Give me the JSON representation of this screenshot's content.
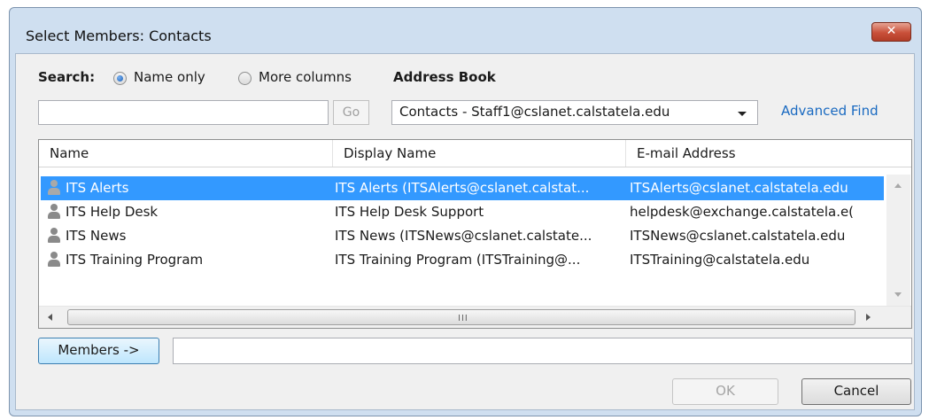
{
  "window": {
    "title": "Select Members: Contacts",
    "close_label": "✕"
  },
  "search": {
    "label": "Search:",
    "option_name_only": "Name only",
    "option_more_columns": "More columns",
    "selected_option": "Name only",
    "input_value": "",
    "go_label": "Go"
  },
  "address_book": {
    "label": "Address Book",
    "selected": "Contacts - Staff1@cslanet.calstatela.edu",
    "advanced_find": "Advanced Find"
  },
  "list": {
    "columns": [
      "Name",
      "Display Name",
      "E-mail Address"
    ],
    "rows": [
      {
        "name": "ITS Alerts",
        "display_name": "ITS Alerts (ITSAlerts@cslanet.calstat...",
        "email": "ITSAlerts@cslanet.calstatela.edu",
        "selected": true
      },
      {
        "name": "ITS Help Desk",
        "display_name": "ITS Help Desk Support",
        "email": "helpdesk@exchange.calstatela.e(",
        "selected": false
      },
      {
        "name": "ITS News",
        "display_name": "ITS News (ITSNews@cslanet.calstate...",
        "email": "ITSNews@cslanet.calstatela.edu",
        "selected": false
      },
      {
        "name": "ITS Training Program",
        "display_name": "ITS Training Program (ITSTraining@...",
        "email": "ITSTraining@calstatela.edu",
        "selected": false
      }
    ],
    "hscroll_grip": "III"
  },
  "members": {
    "button_label": "Members ->",
    "input_value": ""
  },
  "buttons": {
    "ok": "OK",
    "cancel": "Cancel"
  },
  "colors": {
    "selection": "#3399ff",
    "link": "#1a6ac1",
    "frame": "#cfdff0"
  }
}
